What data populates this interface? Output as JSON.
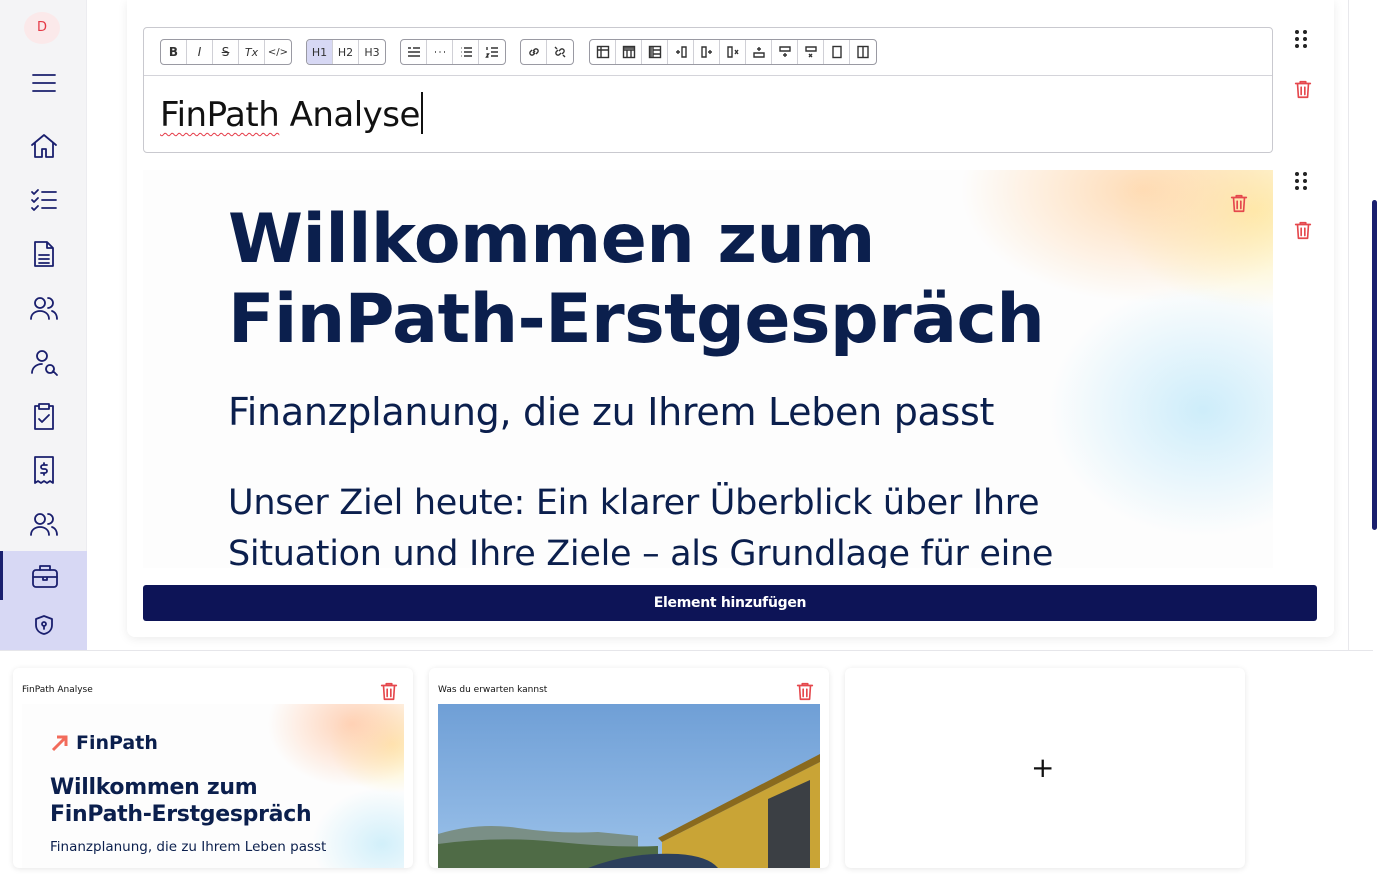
{
  "sidebar": {
    "avatar_initial": "D",
    "items": [
      {
        "name": "menu",
        "icon": "hamburger-icon"
      },
      {
        "name": "home",
        "icon": "home-icon"
      },
      {
        "name": "tasks",
        "icon": "checklist-icon"
      },
      {
        "name": "documents",
        "icon": "document-icon"
      },
      {
        "name": "contacts",
        "icon": "users-icon"
      },
      {
        "name": "search-person",
        "icon": "user-search-icon"
      },
      {
        "name": "clipboard",
        "icon": "clipboard-check-icon"
      },
      {
        "name": "billing",
        "icon": "receipt-dollar-icon"
      },
      {
        "name": "team",
        "icon": "users-icon"
      },
      {
        "name": "portfolio",
        "icon": "briefcase-icon",
        "active": true
      },
      {
        "name": "security",
        "icon": "shield-icon"
      }
    ]
  },
  "toolbar": {
    "groups": [
      [
        "B",
        "I",
        "S",
        "Tx",
        "</>"
      ],
      [
        "H1",
        "H2",
        "H3"
      ],
      [
        "quote",
        "hr",
        "bullet-list",
        "ordered-list"
      ],
      [
        "link",
        "unlink"
      ],
      [
        "table",
        "row-header",
        "col-header",
        "col-before",
        "col-after",
        "col-delete",
        "row-before",
        "row-after",
        "row-delete",
        "merge",
        "split"
      ]
    ],
    "active": "H1"
  },
  "editor": {
    "word1": "FinPath",
    "word2": " Analyse"
  },
  "preview": {
    "heading_line1": "Willkommen zum",
    "heading_line2": "FinPath-Erstgespräch",
    "subtitle": "Finanzplanung, die zu Ihrem Leben passt",
    "body_line1": "Unser Ziel heute: Ein klarer Überblick über Ihre",
    "body_line2": "Situation und Ihre Ziele – als Grundlage für eine"
  },
  "add_button_label": "Element hinzufügen",
  "thumbnails": [
    {
      "title": "FinPath Analyse",
      "logo_text": "FinPath",
      "heading_line1": "Willkommen zum",
      "heading_line2": "FinPath-Erstgespräch",
      "subtitle": "Finanzplanung, die zu Ihrem Leben passt"
    },
    {
      "title": "Was du erwarten kannst"
    }
  ],
  "add_slide_symbol": "+",
  "colors": {
    "primary": "#0d1457",
    "danger": "#e5484d",
    "heading": "#0b1f4d",
    "active_nav": "#d7d8f4"
  }
}
